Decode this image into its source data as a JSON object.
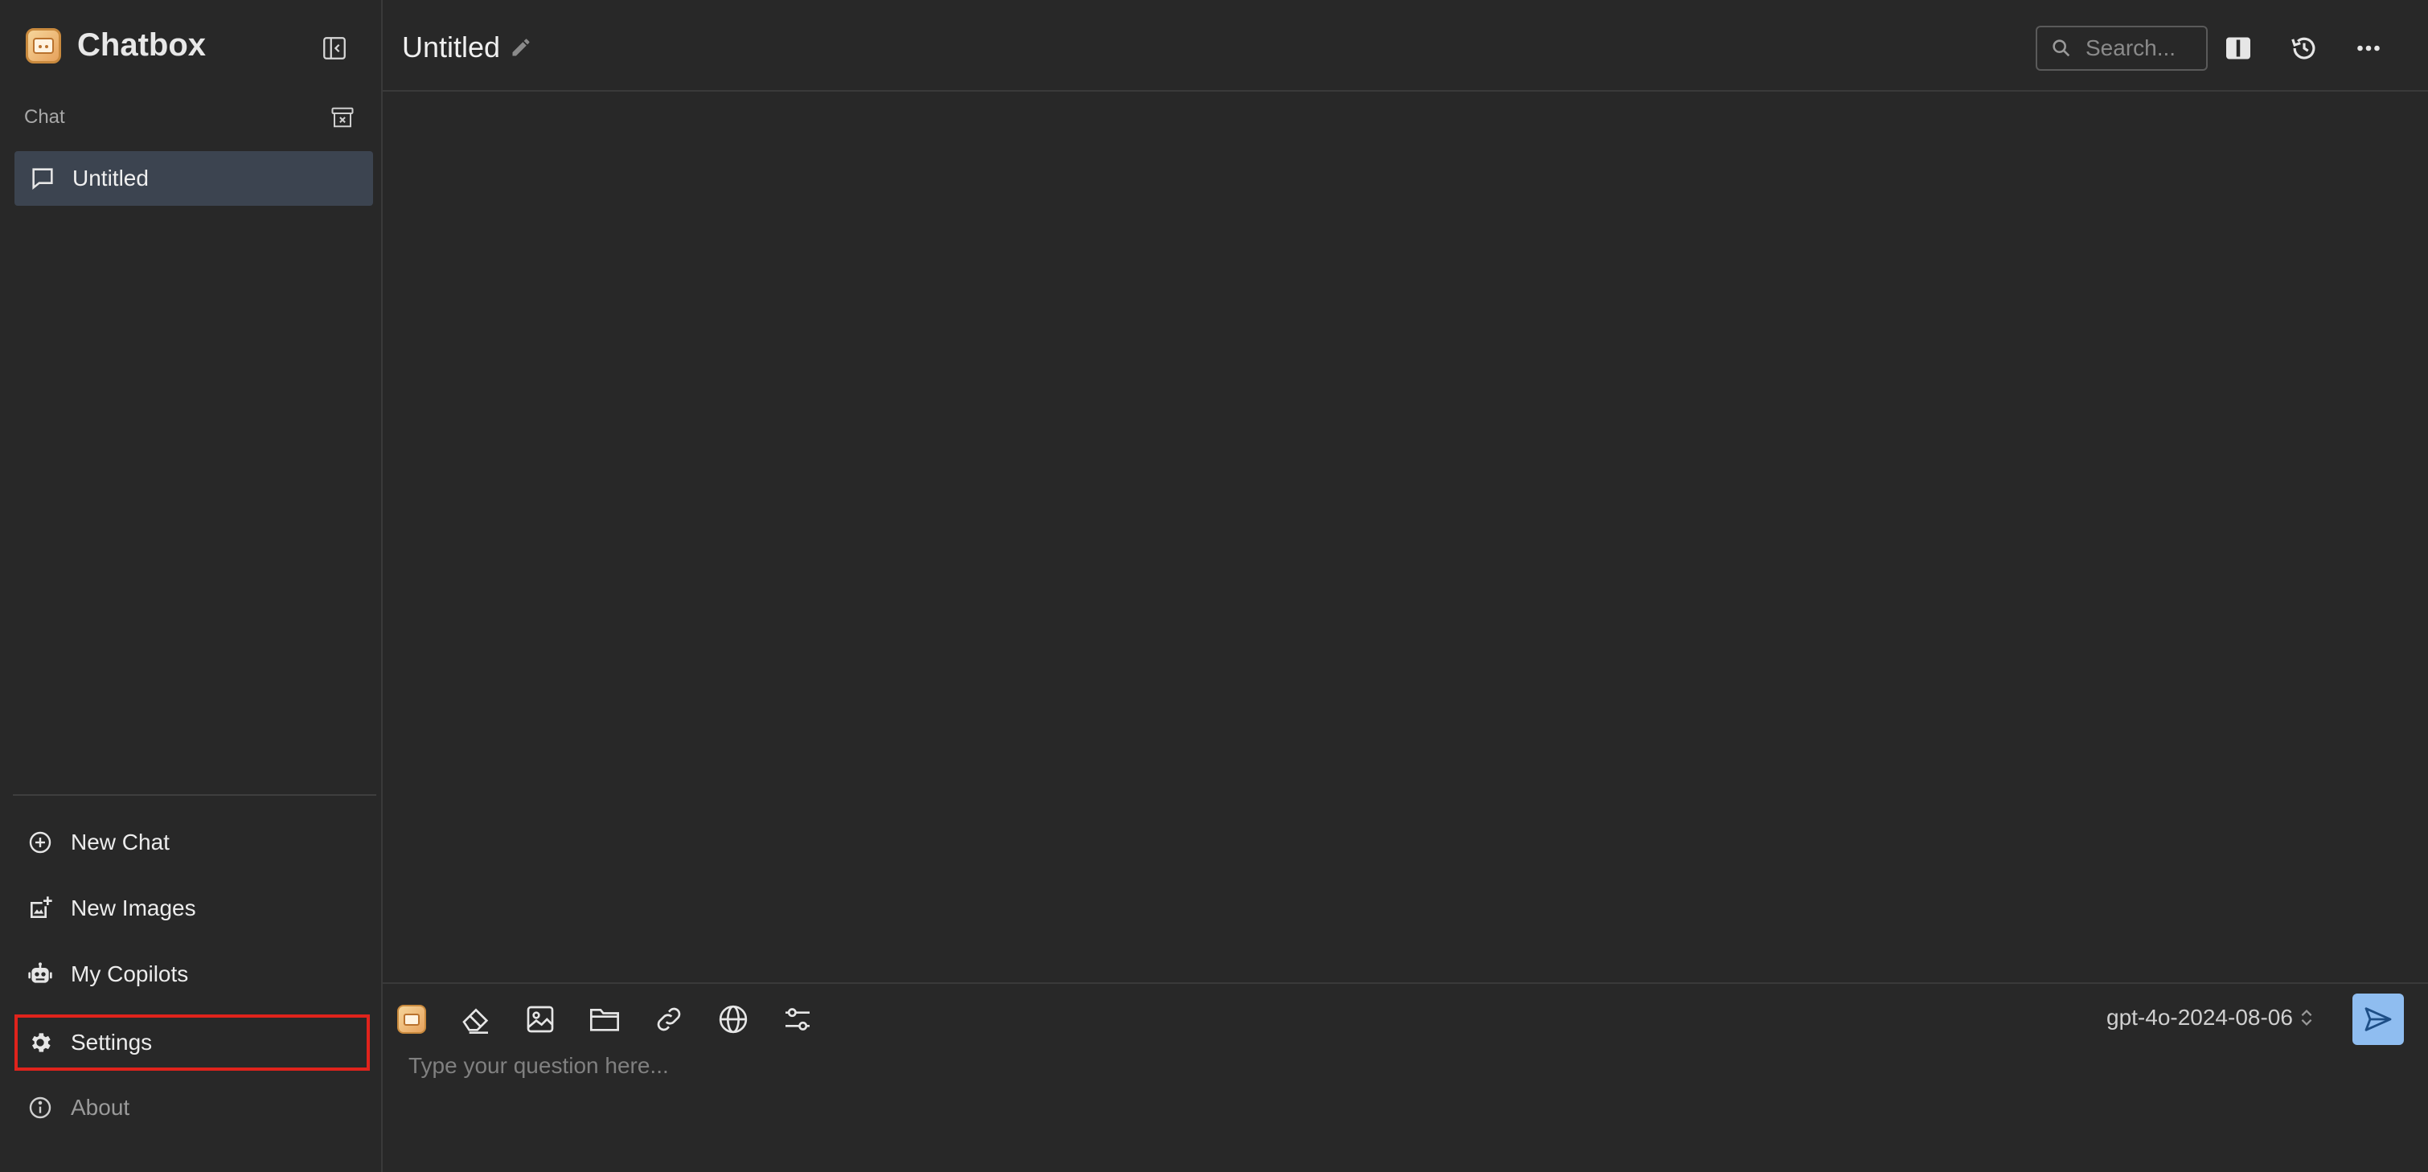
{
  "app": {
    "name": "Chatbox"
  },
  "sidebar": {
    "section_label": "Chat",
    "sessions": [
      {
        "label": "Untitled",
        "icon": "chat-bubble-icon",
        "selected": true
      }
    ],
    "nav": [
      {
        "label": "New Chat",
        "icon": "plus-circle-icon"
      },
      {
        "label": "New Images",
        "icon": "image-add-icon"
      },
      {
        "label": "My Copilots",
        "icon": "robot-icon"
      },
      {
        "label": "Settings",
        "icon": "gear-icon",
        "highlighted": true
      },
      {
        "label": "About",
        "icon": "info-icon"
      }
    ]
  },
  "header": {
    "title": "Untitled",
    "search_placeholder": "Search..."
  },
  "composer": {
    "placeholder": "Type your question here...",
    "model": "gpt-4o-2024-08-06",
    "tools": [
      "copilot-icon",
      "eraser-icon",
      "image-icon",
      "folder-icon",
      "link-icon",
      "globe-icon",
      "sliders-icon"
    ]
  },
  "colors": {
    "background": "#282828",
    "selected_session": "#3c4450",
    "highlight_border": "#e0231c",
    "send_button": "#8fbdf0"
  }
}
